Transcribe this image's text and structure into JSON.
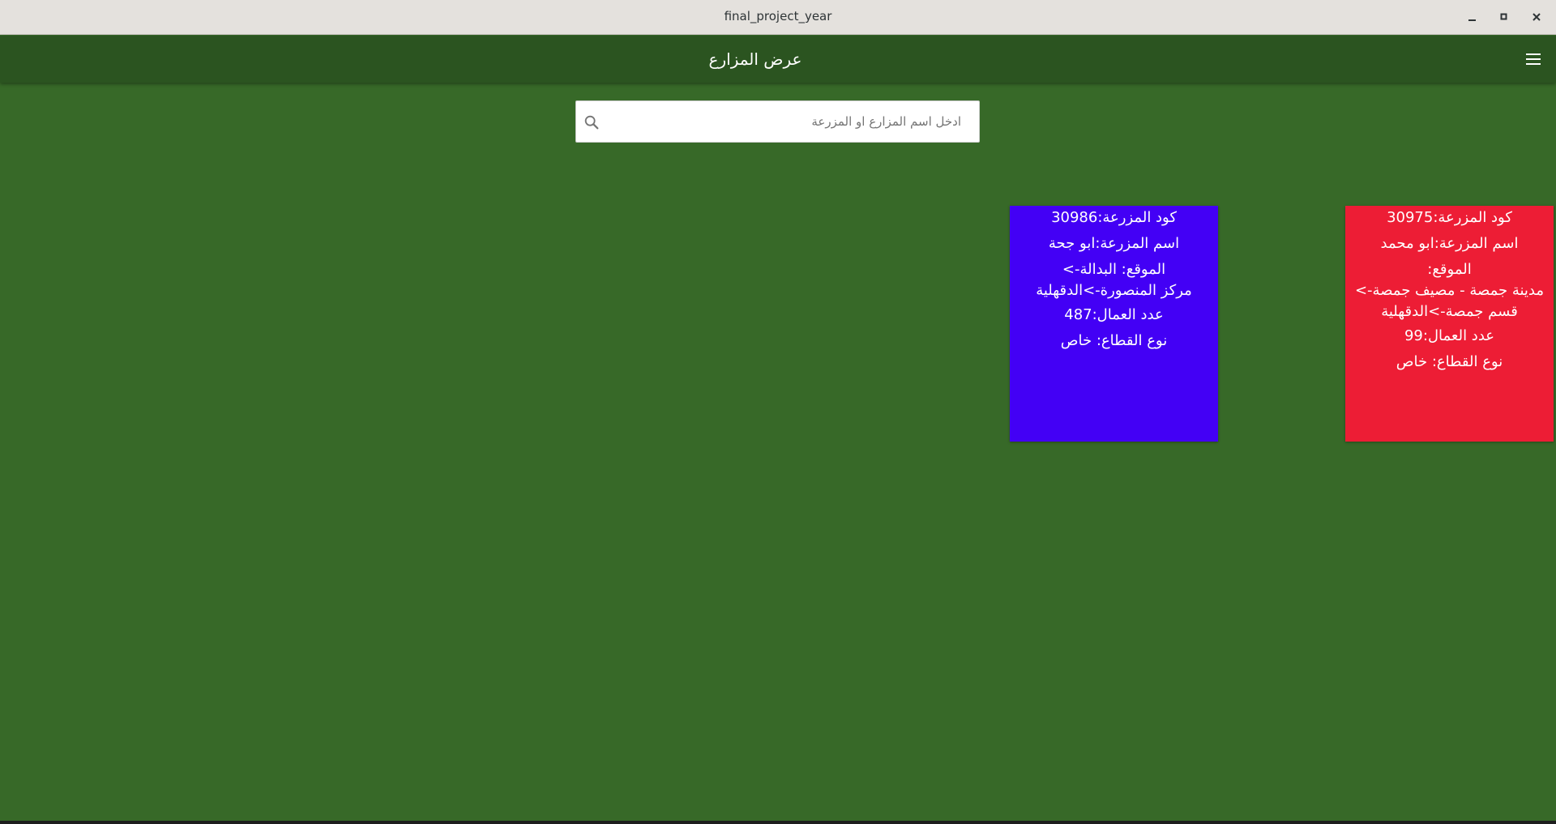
{
  "window": {
    "title": "final_project_year",
    "minimize_icon": "minimize-icon",
    "maximize_icon": "maximize-icon",
    "close_icon": "close-icon"
  },
  "appbar": {
    "title": "عرض المزارع",
    "menu_icon": "hamburger-menu-icon"
  },
  "search": {
    "placeholder": "ادخل اسم المزارع او المزرعة",
    "value": "",
    "icon": "search-icon"
  },
  "colors": {
    "background": "#376928",
    "appbar": "#2b5420",
    "card_blue": "#4300f5",
    "card_red": "#ed1d35"
  },
  "farms": [
    {
      "code_line": "كود المزرعة:30986",
      "name_line": "اسم المزرعة:ابو جحة",
      "location_line1": "الموقع: البدالة->",
      "location_line2": "مركز المنصورة->الدقهلية",
      "location_line3": "",
      "workers_line": "عدد العمال:487",
      "sector_line": "نوع القطاع: خاص"
    },
    {
      "code_line": "كود المزرعة:30975",
      "name_line": "اسم المزرعة:ابو محمد",
      "location_line1": "الموقع:",
      "location_line2": "مدينة جمصة - مصيف جمصة->",
      "location_line3": "قسم جمصة->الدقهلية",
      "workers_line": "عدد العمال:99",
      "sector_line": "نوع القطاع: خاص"
    }
  ]
}
